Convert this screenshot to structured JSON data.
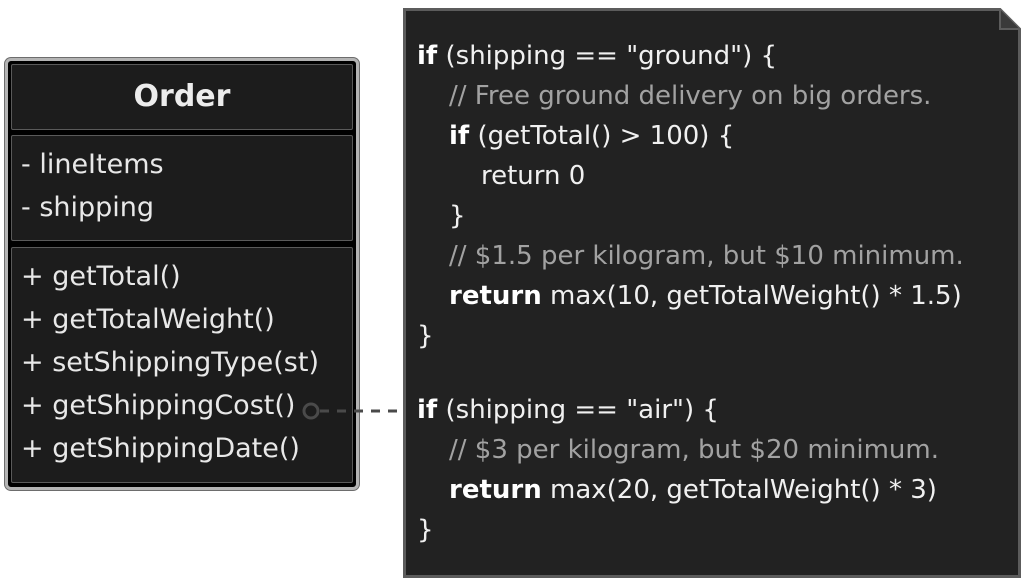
{
  "uml_class": {
    "name": "Order",
    "fields": [
      "- lineItems",
      "- shipping"
    ],
    "methods": [
      "+ getTotal()",
      "+ getTotalWeight()",
      "+ setShippingType(st)",
      "+ getShippingCost()",
      "+ getShippingDate()"
    ]
  },
  "note": {
    "ground_block": {
      "line1_kw": "if",
      "line1_rest": " (shipping == \"ground\") {",
      "comment1": "// Free ground delivery on big orders.",
      "line3_kw": "if",
      "line3_rest": " (getTotal() > 100) {",
      "line4": "return 0",
      "line5": "}",
      "comment2": "// $1.5 per kilogram, but $10 minimum.",
      "line7_kw": "return",
      "line7_rest": " max(10, getTotalWeight() * 1.5)",
      "line8": "}"
    },
    "air_block": {
      "line1_kw": "if",
      "line1_rest": " (shipping == \"air\") {",
      "comment1": "// $3 per kilogram, but $20 minimum.",
      "line3_kw": "return",
      "line3_rest": " max(20, getTotalWeight() * 3)",
      "line4": "}"
    }
  },
  "colors": {
    "background": "#ffffff",
    "uml_fill": "#1c1c1c",
    "uml_border": "#b4b4b4",
    "note_fill": "#222222",
    "text": "#f0f0f0",
    "comment": "#a2a2a2",
    "connector": "#4a4a4a"
  }
}
